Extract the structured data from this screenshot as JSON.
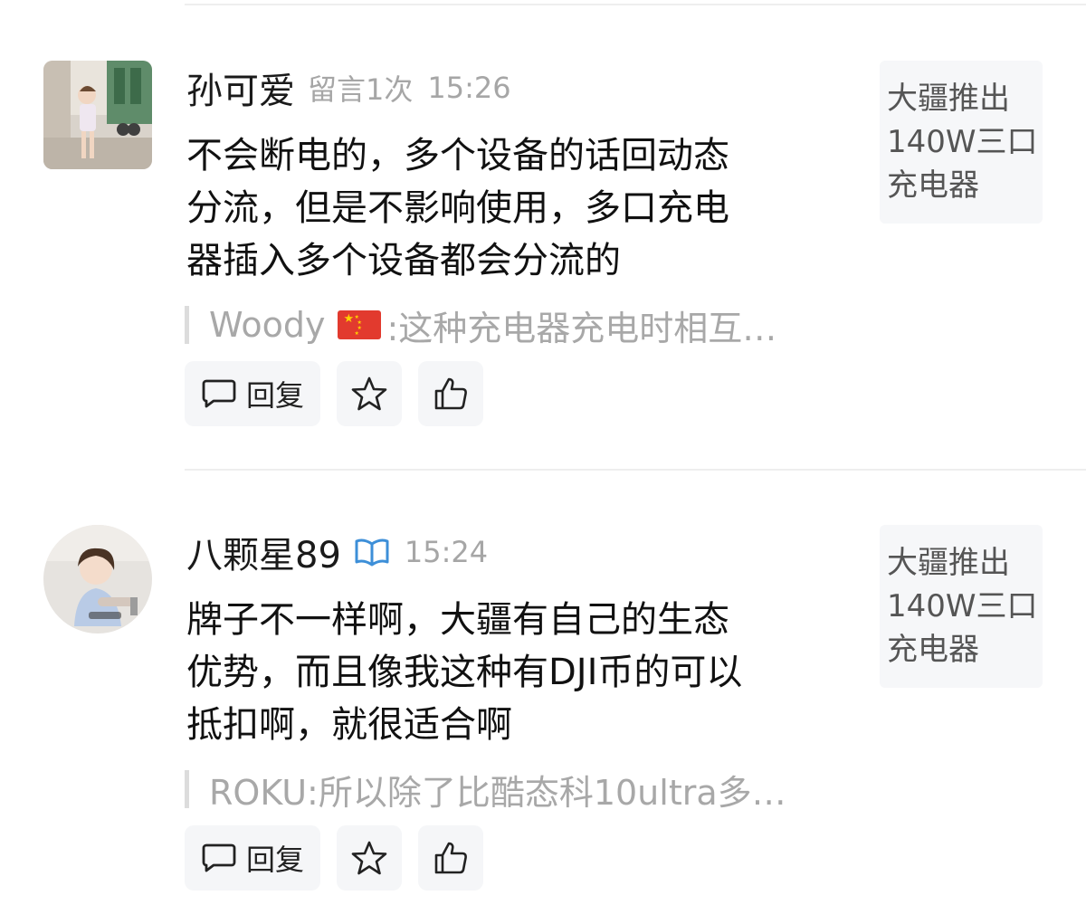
{
  "comments": [
    {
      "username": "孙可爱",
      "meta": "留言1次",
      "time": "15:26",
      "body_lines": [
        "不会断电的，多个设备的话回动态",
        "分流，但是不影响使用，多口充电",
        "器插入多个设备都会分流的"
      ],
      "quote": {
        "author": "Woody",
        "flag_icon": "china-flag-icon",
        "text": ":这种充电器充电时相互…"
      },
      "reply_label": "回复",
      "card_title_lines": [
        "大疆推出",
        "140W三口",
        "充电器"
      ]
    },
    {
      "username": "八颗星89",
      "badge_icon": "verified-book-icon",
      "time": "15:24",
      "body_lines": [
        "牌子不一样啊，大疆有自己的生态",
        "优势，而且像我这种有DJI币的可以",
        "抵扣啊，就很适合啊"
      ],
      "quote": {
        "author": "",
        "text": "ROKU:所以除了比酷态科10ultra多…"
      },
      "reply_label": "回复",
      "card_title_lines": [
        "大疆推出",
        "140W三口",
        "充电器"
      ]
    }
  ],
  "colors": {
    "badge": "#3d8fd8",
    "flag": "#e23a2e",
    "button_bg": "#f5f6f8"
  }
}
